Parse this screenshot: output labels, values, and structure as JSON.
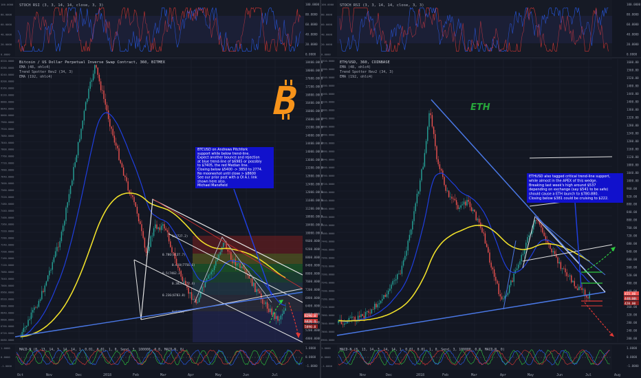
{
  "colors": {
    "bg": "#131722",
    "grid": "#1e2230",
    "up": "#26a69a",
    "down": "#ef5350",
    "ema48": "#1f3fe0",
    "ema192": "#f0e02a",
    "white_line": "#e6e6e6",
    "note_bg": "#1111cc",
    "eth_green": "#26a63a",
    "btc_orange": "#f7931a"
  },
  "left": {
    "stoch_header": "STOCH RSI (3, 3, 14, 14, close, 3, 3)",
    "title": "Bitcoin / US Dollar Perpetual Inverse Swap Contract, 360, BITMEX",
    "legend": [
      "EMA (48, ohlc4)",
      "Trend Spotter Rev2 (34, 3)",
      "EMA (192, ohlc4)"
    ],
    "price_ticks": [
      "18400.0000",
      "18000.0000",
      "17600.0000",
      "17200.0000",
      "16800.0000",
      "16400.0000",
      "16000.0000",
      "15600.0000",
      "15200.0000",
      "14800.0000",
      "14400.0000",
      "14000.0000",
      "13600.0000",
      "13200.0000",
      "12800.0000",
      "12400.0000",
      "12000.0000",
      "11600.0000",
      "11200.0000",
      "10800.0000",
      "10400.0000",
      "10000.0000",
      "9600.0000",
      "9200.0000",
      "8800.0000",
      "8400.0000",
      "8000.0000",
      "7600.0000",
      "7200.0000",
      "6800.0000",
      "6400.0000",
      "6000.0000",
      "5600.0000",
      "5200.0000",
      "4800.0000"
    ],
    "left_ticks": [
      "8320.0000",
      "8280.0000",
      "8240.0000",
      "8200.0000",
      "8160.0000",
      "8120.0000",
      "8080.0000",
      "8040.0000",
      "8000.0000",
      "7960.0000",
      "7920.0000",
      "7880.0000",
      "7840.0000",
      "7800.0000",
      "7760.0000",
      "7720.0000",
      "7680.0000",
      "7640.0000",
      "7600.0000",
      "7560.0000",
      "7520.0000",
      "7480.0000",
      "7440.0000",
      "7400.0000",
      "7360.0000",
      "7320.0000",
      "7280.0000",
      "7240.0000",
      "7200.0000",
      "7160.0000",
      "7120.0000",
      "7080.0000",
      "7040.0000",
      "7000.0000",
      "6960.0000",
      "6920.0000",
      "6880.0000",
      "6840.0000",
      "6800.0000",
      "6760.0000",
      "6720.0000",
      "6680.0000"
    ],
    "stoch_ticks": [
      "100.0000",
      "80.0000",
      "60.0000",
      "40.0000",
      "20.0000",
      "0.0000"
    ],
    "macd_header": "MACD-N (8, 13, 14, 3, 14, 14, 1, 0.01, 0.01, 1, 0, Send, 3, 100000, 0.8, MACD-N, 0)",
    "macd_ticks": [
      "1.0000",
      "0.0000",
      "-1.0000"
    ],
    "fib_labels": [
      "1(8727.2)",
      "0.786(8137.7)",
      "0.618(7756.6)",
      "0.5(7462.2)",
      "0.382(7172.4)",
      "0.236(6783.8)",
      "0(6194)"
    ],
    "price_tags": [
      "6290.0",
      "6030.0",
      "5890.0"
    ],
    "x_labels": [
      "Oct",
      "Nov",
      "Dec",
      "2018",
      "Feb",
      "Mar",
      "Apr",
      "May",
      "Jun",
      "Jul"
    ],
    "note": [
      "BTCUSD on Andrews Pitchfork",
      "support while below trend-line.",
      "Expect another bounce and rejection",
      "at blue trend-line of $6985 or possibly",
      "to $7405, the red Median line.",
      "Closing below $5400 -> 3850 to 2774.",
      "No mooneshot until close > $8600",
      "See our prior post with a OI  A.I. link",
      "shown here also.",
      "Michael Mansfield"
    ]
  },
  "right": {
    "stoch_header": "STOCH RSI (3, 3, 14, 14, close, 3, 3)",
    "title": "ETH/USD, 360, COINBASE",
    "legend": [
      "EMA (48, ohlc4)",
      "Trend Spotter Rev2 (34, 3)",
      "EMA (192, ohlc4)"
    ],
    "eth_label": "ETH",
    "price_ticks": [
      "1600.00",
      "1560.00",
      "1520.00",
      "1480.00",
      "1440.00",
      "1400.00",
      "1360.00",
      "1320.00",
      "1280.00",
      "1240.00",
      "1200.00",
      "1160.00",
      "1120.00",
      "1080.00",
      "1040.00",
      "1000.00",
      "960.00",
      "920.00",
      "880.00",
      "840.00",
      "800.00",
      "760.00",
      "720.00",
      "680.00",
      "640.00",
      "600.00",
      "560.00",
      "520.00",
      "480.00",
      "440.00",
      "400.00",
      "360.00",
      "320.00",
      "280.00",
      "240.00",
      "200.00"
    ],
    "left_ticks": [
      "8320.0000",
      "8280.0000",
      "8240.0000",
      "8200.0000",
      "8160.0000",
      "8120.0000",
      "8080.0000",
      "8040.0000",
      "8000.0000",
      "7960.0000",
      "7920.0000",
      "7880.0000",
      "7840.0000",
      "7800.0000",
      "7760.0000",
      "7720.0000",
      "7680.0000",
      "7640.0000",
      "7600.0000",
      "7560.0000",
      "7520.0000",
      "7480.0000",
      "7440.0000",
      "7400.0000",
      "7360.0000",
      "7320.0000",
      "7280.0000",
      "7240.0000",
      "7200.0000",
      "7160.0000",
      "7120.0000",
      "7080.0000",
      "7040.0000",
      "7000.0000",
      "6960.0000"
    ],
    "stoch_ticks": [
      "100.0000",
      "80.0000",
      "60.0000",
      "40.0000",
      "20.0000",
      "0.0000"
    ],
    "macd_header": "MACD-N (8, 13, 14, 3, 14, 14, 1, 0.01, 0.01, 1, 0, Send, 3, 100000, 0.8, MACD-N, 0)",
    "macd_ticks": [
      "1.0000",
      "0.0000",
      "-1.0000"
    ],
    "price_tags": [
      "455.00",
      "440.00",
      "420.00"
    ],
    "x_labels": [
      "Nov",
      "Dec",
      "2018",
      "Feb",
      "Mar",
      "Apr",
      "May",
      "Jun",
      "Jul",
      "Aug"
    ],
    "note": [
      "ETHUSD also tagged critical trend-line support,",
      "while almost in the APEX of this wedge.",
      "Breaking last week's high around $537",
      "depending on exchange (say $541 to be safe)",
      "should cause a ETH launch to $780-880.",
      "Closing below $381 could be cruising to $222."
    ]
  },
  "chart_data": [
    {
      "type": "line",
      "title": "Bitcoin / US Dollar Perpetual Inverse Swap Contract, 360, BITMEX",
      "xlabel": "",
      "ylabel": "",
      "x": [
        "Oct",
        "Nov",
        "Dec",
        "2018",
        "Feb",
        "Mar",
        "Apr",
        "May",
        "Jun",
        "Jul"
      ],
      "series": [],
      "approx_close": [
        4300,
        6200,
        10500,
        14000,
        9000,
        9500,
        7000,
        9600,
        6500,
        6300
      ],
      "ylim": [
        4800,
        18400
      ],
      "grid": true
    },
    {
      "type": "line",
      "title": "ETH/USD, 360, COINBASE",
      "xlabel": "",
      "ylabel": "",
      "x": [
        "Nov",
        "Dec",
        "2018",
        "Feb",
        "Mar",
        "Apr",
        "May",
        "Jun",
        "Jul",
        "Aug"
      ],
      "series": [],
      "approx_close": [
        300,
        450,
        900,
        850,
        700,
        400,
        780,
        600,
        450,
        460
      ],
      "ylim": [
        200,
        1600
      ],
      "grid": true
    }
  ]
}
